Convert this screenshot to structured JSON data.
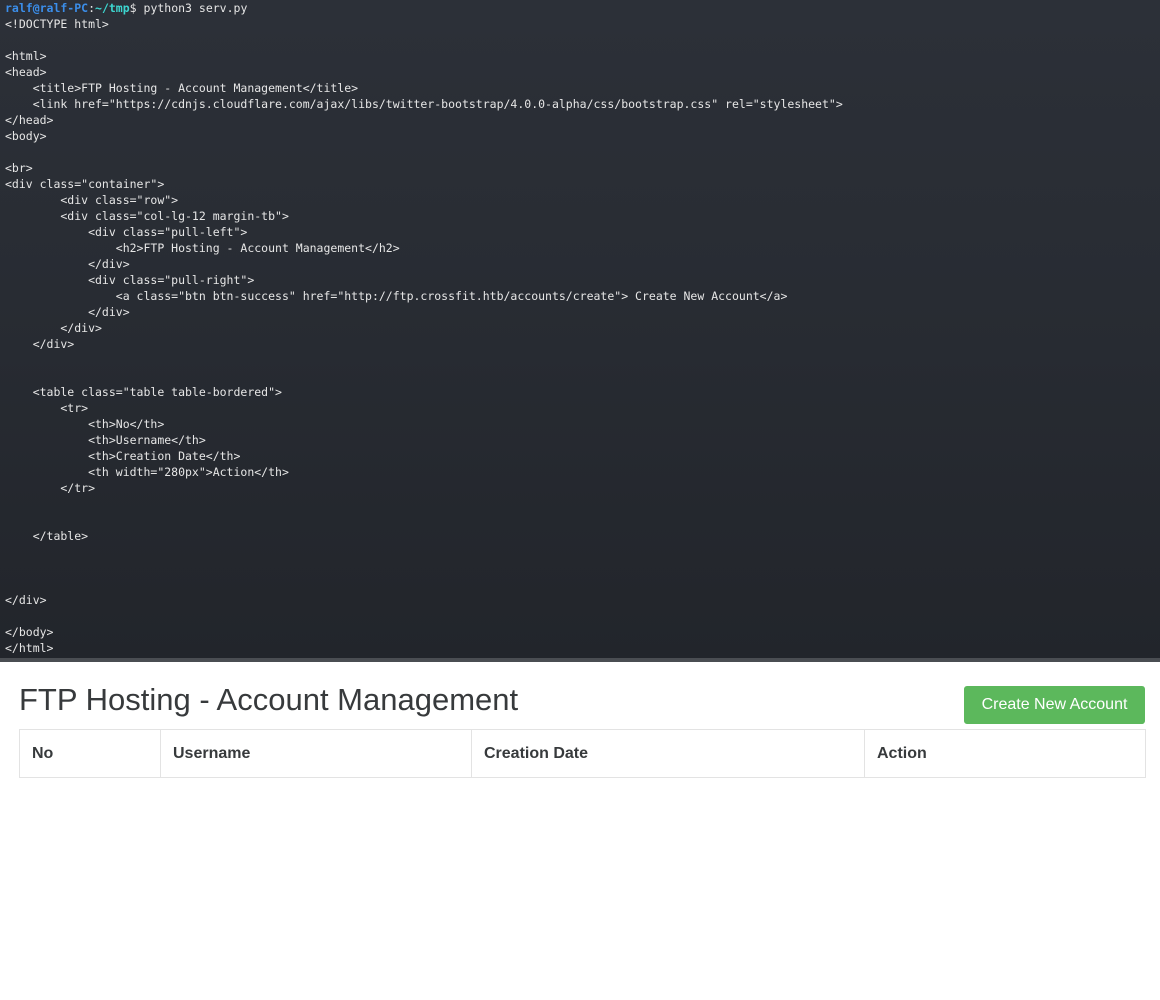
{
  "terminal": {
    "prompt": {
      "user_host": "ralf@ralf-PC",
      "separator": ":",
      "path": "~/tmp",
      "symbol": "$",
      "command": " python3 serv.py"
    },
    "lines": [
      "<!DOCTYPE html>",
      "",
      "<html>",
      "<head>",
      "    <title>FTP Hosting - Account Management</title>",
      "    <link href=\"https://cdnjs.cloudflare.com/ajax/libs/twitter-bootstrap/4.0.0-alpha/css/bootstrap.css\" rel=\"stylesheet\">",
      "</head>",
      "<body>",
      "",
      "<br>",
      "<div class=\"container\">",
      "        <div class=\"row\">",
      "        <div class=\"col-lg-12 margin-tb\">",
      "            <div class=\"pull-left\">",
      "                <h2>FTP Hosting - Account Management</h2>",
      "            </div>",
      "            <div class=\"pull-right\">",
      "                <a class=\"btn btn-success\" href=\"http://ftp.crossfit.htb/accounts/create\"> Create New Account</a>",
      "            </div>",
      "        </div>",
      "    </div>",
      "",
      "",
      "    <table class=\"table table-bordered\">",
      "        <tr>",
      "            <th>No</th>",
      "            <th>Username</th>",
      "            <th>Creation Date</th>",
      "            <th width=\"280px\">Action</th>",
      "        </tr>",
      "",
      "",
      "    </table>",
      "",
      "",
      "",
      "</div>",
      "",
      "</body>",
      "</html>"
    ],
    "colors": {
      "user_host": "#3b8eea",
      "path": "#3dd6d0",
      "text": "#e6e6e6",
      "background": "#282c33"
    }
  },
  "page": {
    "title": "FTP Hosting - Account Management",
    "create_button_label": "Create New Account",
    "table": {
      "headers": [
        "No",
        "Username",
        "Creation Date",
        "Action"
      ]
    },
    "colors": {
      "button": "#5cb85c",
      "text": "#373a3c",
      "border": "#e3e3e3"
    }
  }
}
